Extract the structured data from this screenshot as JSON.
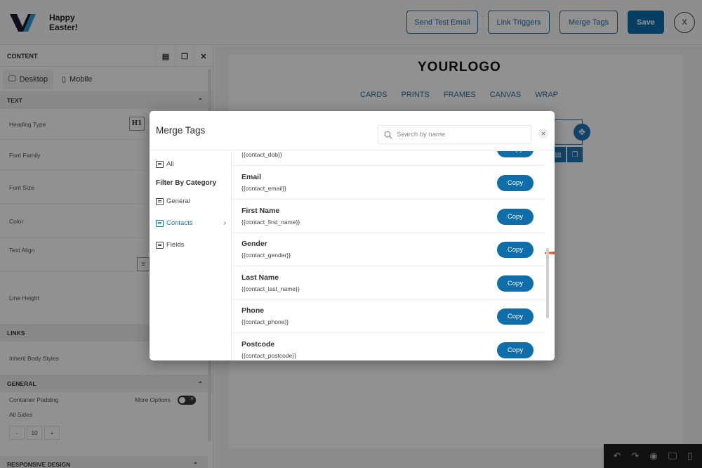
{
  "header": {
    "brand_line1": "Happy",
    "brand_line2": "Easter!",
    "buttons": {
      "send_test_email": "Send Test Email",
      "link_triggers": "Link Triggers",
      "merge_tags": "Merge Tags",
      "save": "Save",
      "close": "X"
    }
  },
  "sidebar": {
    "title": "CONTENT",
    "tabs": {
      "desktop": "Desktop",
      "mobile": "Mobile"
    },
    "sections": {
      "text": "TEXT",
      "links": "LINKS",
      "general": "GENERAL",
      "responsive": "RESPONSIVE DESIGN"
    },
    "rows": {
      "heading_type": "Heading Type",
      "heading_value": "H1",
      "font_family": "Font Family",
      "font_size": "Font Size",
      "color": "Color",
      "text_align": "Text Align",
      "line_height": "Line Height",
      "inherit_body_styles": "Inherit Body Styles",
      "container_padding": "Container Padding",
      "more_options": "More Options",
      "all_sides": "All Sides",
      "padding_minus": "-",
      "padding_value": "10",
      "padding_plus": "+"
    }
  },
  "email_preview": {
    "logo": "YOURLOGO",
    "nav": [
      "CARDS",
      "PRINTS",
      "FRAMES",
      "CANVAS",
      "WRAP"
    ]
  },
  "modal": {
    "title": "Merge Tags",
    "search_placeholder": "Search by name",
    "search_value": "",
    "categories_label": "Filter By Category",
    "all_label": "All",
    "categories": [
      {
        "label": "General",
        "active": false
      },
      {
        "label": "Contacts",
        "active": true
      },
      {
        "label": "Fields",
        "active": false
      }
    ],
    "copy_label": "Copy",
    "tags": [
      {
        "name": "",
        "code": "{{contact_dob}}"
      },
      {
        "name": "Email",
        "code": "{{contact_email}}"
      },
      {
        "name": "First Name",
        "code": "{{contact_first_name}}",
        "highlighted": true
      },
      {
        "name": "Gender",
        "code": "{{contact_gender}}"
      },
      {
        "name": "Last Name",
        "code": "{{contact_last_name}}"
      },
      {
        "name": "Phone",
        "code": "{{contact_phone}}"
      },
      {
        "name": "Postcode",
        "code": "{{contact_postcode}}"
      }
    ]
  },
  "colors": {
    "accent": "#0f6eaa",
    "active_category": "#1d77a8",
    "annotation_arrow": "#e0581c",
    "logo_dot": "#f2581c"
  }
}
